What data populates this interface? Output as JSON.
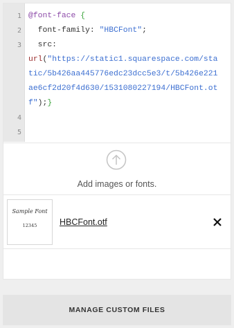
{
  "editor": {
    "line_numbers": [
      "1",
      "2",
      "3",
      "4",
      "5"
    ],
    "code": {
      "at_rule": "@font-face",
      "open_brace": "{",
      "prop_family": "font-family",
      "colon": ":",
      "family_value": "\"HBCFont\"",
      "semicolon": ";",
      "prop_src": "src:",
      "url_fn": "url",
      "open_paren": "(",
      "url_line1": "\"https://static1.squarespace.com/sta",
      "url_line2": "tic/5b426aa445776edc23dcc5e3/t/5b426e221",
      "url_line3": "ae6cf2d20f4d630/1531080227194/HBCFont.ot",
      "url_line4": "f\"",
      "close_paren_semi": ");",
      "close_brace": "}"
    }
  },
  "upload": {
    "icon": "upload-arrow-circle-icon",
    "label": "Add images or fonts."
  },
  "files": [
    {
      "thumbnail_title": "Sample Font",
      "thumbnail_numbers": "12345",
      "name": "HBCFont.otf",
      "remove_icon": "close-icon"
    }
  ],
  "footer": {
    "manage_label": "MANAGE CUSTOM FILES"
  }
}
